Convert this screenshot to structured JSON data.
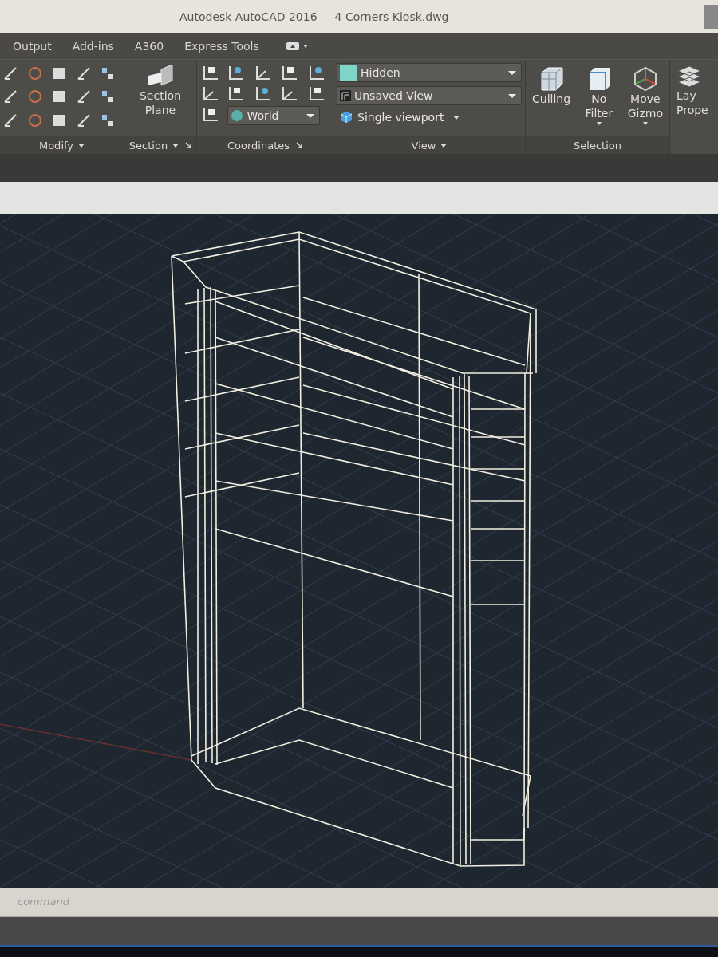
{
  "window": {
    "app_title": "Autodesk AutoCAD 2016",
    "file_title": "4 Corners Kiosk.dwg"
  },
  "tabs": [
    {
      "label": "Output"
    },
    {
      "label": "Add-ins"
    },
    {
      "label": "A360"
    },
    {
      "label": "Express Tools"
    }
  ],
  "ribbon": {
    "modify": {
      "title": "Modify"
    },
    "section": {
      "title": "Section",
      "button_lines": [
        "Section",
        "Plane"
      ]
    },
    "coordinates": {
      "title": "Coordinates",
      "ucs_dropdown": "World"
    },
    "view": {
      "title": "View",
      "visual_style": "Hidden",
      "named_view": "Unsaved View",
      "viewport": "Single viewport"
    },
    "selection": {
      "title": "Selection",
      "buttons": [
        {
          "lines": [
            "Culling"
          ],
          "dropdown": false
        },
        {
          "lines": [
            "No Filter"
          ],
          "dropdown": true
        },
        {
          "lines": [
            "Move",
            "Gizmo"
          ],
          "dropdown": true
        }
      ]
    },
    "layers": {
      "button_lines": [
        "Lay",
        "Prope"
      ]
    }
  },
  "command_line": {
    "placeholder": "command"
  }
}
